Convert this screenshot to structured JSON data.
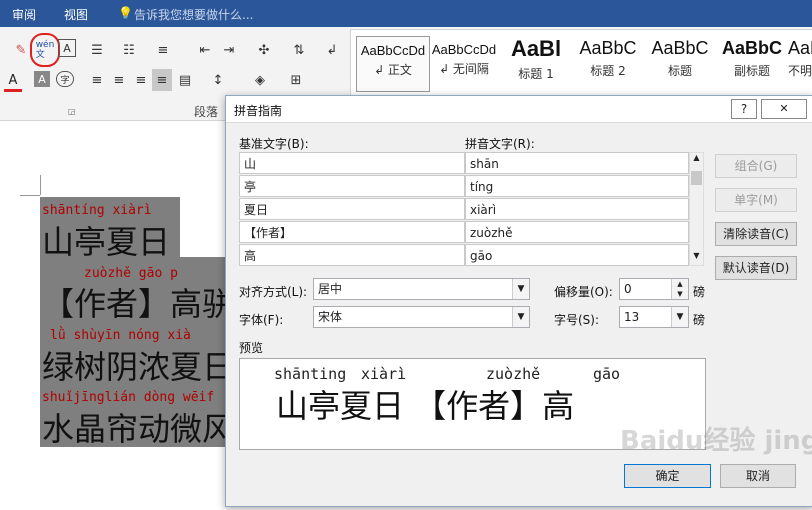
{
  "tabs": {
    "review": "审阅",
    "view": "视图",
    "tell_me": "告诉我您想要做什么..."
  },
  "ribbon": {
    "paragraph_group": "段落",
    "styles": [
      {
        "preview": "AaBbCcDd",
        "name": "↲ 正文"
      },
      {
        "preview": "AaBbCcDd",
        "name": "↲ 无间隔"
      },
      {
        "preview": "AaBl",
        "name": "标题 1"
      },
      {
        "preview": "AaBbC",
        "name": "标题 2"
      },
      {
        "preview": "AaBbC",
        "name": "标题"
      },
      {
        "preview": "AaBbC",
        "name": "副标题"
      },
      {
        "preview": "AaBbC",
        "name": "不明"
      }
    ],
    "phonetic_btn": "wén 文"
  },
  "document": {
    "lines": [
      {
        "pinyin": "shāntíng  xiàrì",
        "text": "山亭夏日"
      },
      {
        "pinyin": "zuòzhě  gāo p",
        "text": "【作者】高骈"
      },
      {
        "pinyin": "lǜ  shùyīn nóng  xià",
        "text": "绿树阴浓夏日"
      },
      {
        "pinyin": "shuǐjīnglián dòng wēif",
        "text": "水晶帘动微风"
      }
    ]
  },
  "dialog": {
    "title": "拼音指南",
    "help": "?",
    "close": "✕",
    "base_header": "基准文字(B):",
    "ruby_header": "拼音文字(R):",
    "rows": [
      {
        "base": "山",
        "ruby": "shān"
      },
      {
        "base": "亭",
        "ruby": "tíng"
      },
      {
        "base": "夏日",
        "ruby": "xiàrì"
      },
      {
        "base": "【作者】",
        "ruby": "zuòzhě"
      },
      {
        "base": "高",
        "ruby": "gāo"
      }
    ],
    "buttons": {
      "group": "组合(G)",
      "single": "单字(M)",
      "clear": "清除读音(C)",
      "default": "默认读音(D)",
      "ok": "确定",
      "cancel": "取消"
    },
    "alignment_label": "对齐方式(L):",
    "alignment_value": "居中",
    "offset_label": "偏移量(O):",
    "offset_value": "0",
    "font_label": "字体(F):",
    "font_value": "宋体",
    "size_label": "字号(S):",
    "size_value": "13",
    "unit": "磅",
    "preview_label": "预览",
    "preview_pinyin": [
      "shānting",
      "xiàrì",
      "zuòzhě",
      "gāo"
    ],
    "preview_text": "山亭夏日 【作者】高"
  },
  "watermark": "Baidu经验 jingyan.baidu.com"
}
